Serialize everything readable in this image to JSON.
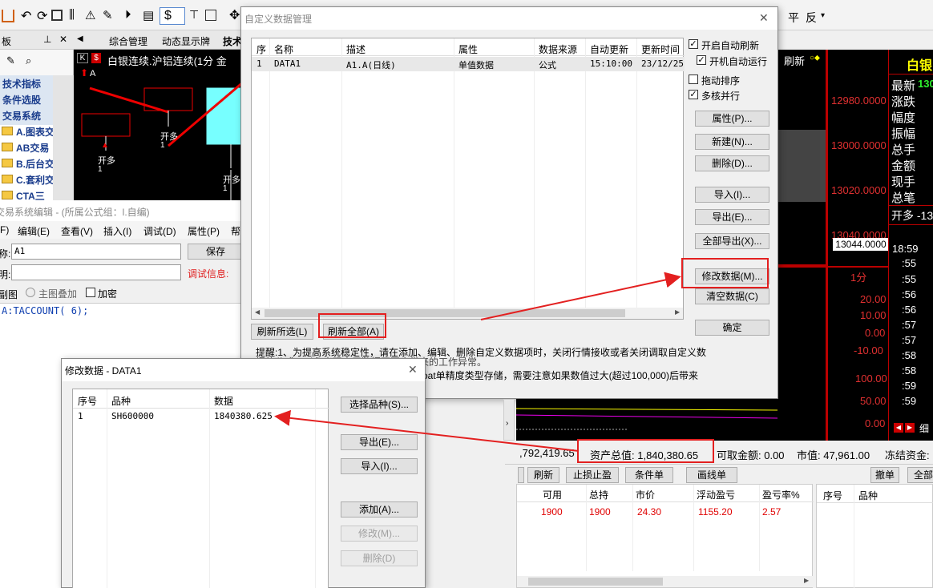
{
  "toolbar": {
    "currency_symbol": "$",
    "right_buttons": [
      "平",
      "反"
    ]
  },
  "left_panel": {
    "title": "板",
    "items": [
      "技术指标",
      "条件选股",
      "交易系统"
    ],
    "folders": [
      "A.图表交",
      "AB交易",
      "B.后台交",
      "C.套利交",
      "CTA三"
    ]
  },
  "tabs": [
    "综合管理",
    "动态显示牌",
    "技术"
  ],
  "chart_header": {
    "k_label": "K",
    "text": "白银连续.沪铝连续(1分  金",
    "arrow_label": "A"
  },
  "chart_labels": [
    {
      "text": "开多",
      "num": "1"
    },
    {
      "text": "开多",
      "num": "1"
    },
    {
      "text": "开多",
      "num": "1"
    }
  ],
  "formula_editor": {
    "title": "交易系统编辑 - (所属公式组：l.自编)",
    "menu": [
      "F)",
      "编辑(E)",
      "查看(V)",
      "插入(I)",
      "调试(D)",
      "属性(P)",
      "帮"
    ],
    "name_label": "称:",
    "name_value": "A1",
    "desc_label": "明:",
    "save_label": "保存",
    "debug_label": "调试信息:",
    "option_label_1": "副图",
    "option_label_2": "主图叠加",
    "option_label_3": "加密",
    "code": "A:TACCOUNT( 6);"
  },
  "dialog_custom": {
    "title": "自定义数据管理",
    "close": "✕",
    "columns": [
      "序",
      "名称",
      "描述",
      "属性",
      "数据来源",
      "自动更新",
      "更新时间"
    ],
    "rows": [
      [
        "1",
        "DATA1",
        "A1.A(日线)",
        "单值数据",
        "公式",
        "15:10:00",
        "23/12/25"
      ]
    ],
    "checks": [
      {
        "label": "开启自动刷新",
        "checked": true
      },
      {
        "label": "开机自动运行",
        "checked": true
      },
      {
        "label": "拖动排序",
        "checked": false
      },
      {
        "label": "多核并行",
        "checked": true
      }
    ],
    "buttons": [
      "属性(P)...",
      "新建(N)...",
      "删除(D)...",
      "导入(I)...",
      "导出(E)...",
      "全部导出(X)...",
      "修改数据(M)...",
      "清空数据(C)",
      "确定"
    ],
    "refresh_selected": "刷新所选(L)",
    "refresh_all": "刷新全部(A)",
    "note_line1": "提醒:1、为提高系统稳定性，请在添加、编辑、删除自定义数据项时，关闭行情接收或者关闭调取自定义数",
    "note_line2": "据的公式，以免出现由于数据不同步带来的工作异常。",
    "note_line3": "oat单精度类型存储，需要注意如果数值过大(超过100,000)后带来"
  },
  "dialog_modify": {
    "title": "修改数据 - DATA1",
    "close": "✕",
    "columns": [
      "序号",
      "品种",
      "数据"
    ],
    "rows": [
      [
        "1",
        "SH600000",
        "1840380.625"
      ]
    ],
    "buttons": [
      {
        "label": "选择品种(S)...",
        "enabled": true
      },
      {
        "label": "导出(E)...",
        "enabled": true
      },
      {
        "label": "导入(I)...",
        "enabled": true
      },
      {
        "label": "添加(A)...",
        "enabled": true
      },
      {
        "label": "修改(M)...",
        "enabled": false
      },
      {
        "label": "删除(D)",
        "enabled": false
      }
    ]
  },
  "right_chart": {
    "refresh": "刷新",
    "price_ticks": [
      "12980.0000",
      "13000.0000",
      "13020.0000",
      "13040.0000"
    ],
    "current_price": "13044.0000",
    "period": "1分",
    "lower_ticks": [
      "20.00",
      "10.00",
      "0.00",
      "-10.00",
      "100.00",
      "50.00",
      "0.00"
    ],
    "quote_title": "白银",
    "quote_labels": [
      "最新",
      "涨跌",
      "幅度",
      "振幅",
      "总手",
      "金额",
      "现手",
      "总笔"
    ],
    "latest_value": "130",
    "open_text": "开多 -13",
    "times": [
      "18:59",
      ":55",
      ":55",
      ":56",
      ":56",
      ":57",
      ":57",
      ":58",
      ":58",
      ":59",
      ":59"
    ],
    "detail": "细"
  },
  "account_bar": {
    "balance": ",792,419.65",
    "total_assets": "资产总值: 1,840,380.65",
    "available": "可取金额: 0.00",
    "market_value": "市值: 47,961.00",
    "frozen": "冻结资金:"
  },
  "trade_toolbar": [
    "刷新",
    "止损止盈",
    "条件单",
    "画线单"
  ],
  "trade_right_buttons": [
    "撤单",
    "全部"
  ],
  "positions": {
    "columns": [
      "可用",
      "总持",
      "市价",
      "浮动盈亏",
      "盈亏率%"
    ],
    "rows": [
      [
        "1900",
        "1900",
        "24.30",
        "1155.20",
        "2.57"
      ]
    ],
    "color": "#e00000"
  },
  "orders": {
    "columns": [
      "序号",
      "品种"
    ]
  }
}
